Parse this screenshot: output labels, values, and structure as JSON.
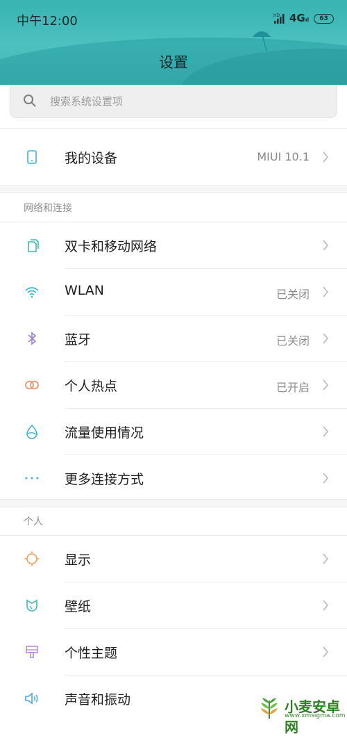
{
  "status": {
    "time": "中午12:00",
    "network": "4G",
    "network_small": "ıl",
    "signal_hd": "HD",
    "battery": "63"
  },
  "header": {
    "title": "设置"
  },
  "search": {
    "placeholder": "搜索系统设置项"
  },
  "my_device": {
    "label": "我的设备",
    "value": "MIUI 10.1"
  },
  "sections": {
    "network": "网络和连接",
    "personal": "个人"
  },
  "network_items": [
    {
      "label": "双卡和移动网络",
      "value": ""
    },
    {
      "label": "WLAN",
      "value": "已关闭"
    },
    {
      "label": "蓝牙",
      "value": "已关闭"
    },
    {
      "label": "个人热点",
      "value": "已开启"
    },
    {
      "label": "流量使用情况",
      "value": ""
    },
    {
      "label": "更多连接方式",
      "value": ""
    }
  ],
  "personal_items": [
    {
      "label": "显示",
      "value": ""
    },
    {
      "label": "壁纸",
      "value": ""
    },
    {
      "label": "个性主题",
      "value": ""
    },
    {
      "label": "声音和振动",
      "value": ""
    }
  ],
  "watermark": {
    "title": "小麦安卓网",
    "url": "www.xmsigma.com"
  },
  "colors": {
    "header": "#43b6b7",
    "accent_teal": "#3bb4c1",
    "bluetooth": "#9b7ee0",
    "hotspot": "#f08a5a",
    "display": "#f39b5a",
    "wallpaper": "#3fb8b0",
    "theme": "#b98be3",
    "sound": "#4aa8e8"
  }
}
